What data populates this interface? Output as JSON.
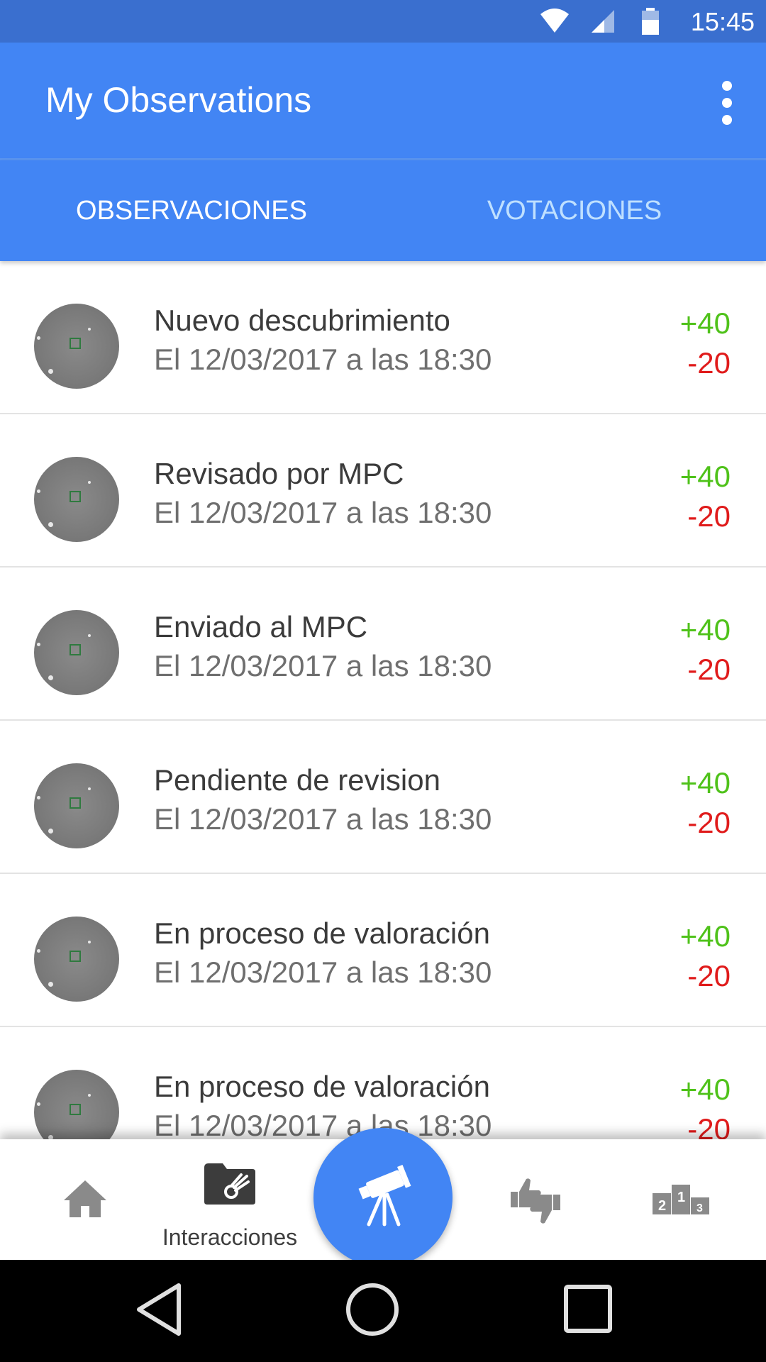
{
  "status_bar": {
    "time": "15:45",
    "icons": [
      "wifi-icon",
      "signal-icon",
      "battery-icon"
    ]
  },
  "app_bar": {
    "title": "My Observations",
    "menu_icon": "more-vert-icon"
  },
  "tabs": [
    {
      "label": "OBSERVACIONES",
      "active": true
    },
    {
      "label": "VOTACIONES",
      "active": false
    }
  ],
  "observations": [
    {
      "title": "Nuevo descubrimiento",
      "date": "El 12/03/2017 a las 18:30",
      "plus": "+40",
      "minus": "-20"
    },
    {
      "title": "Revisado por MPC",
      "date": "El 12/03/2017 a las 18:30",
      "plus": "+40",
      "minus": "-20"
    },
    {
      "title": "Enviado al MPC",
      "date": "El 12/03/2017 a las 18:30",
      "plus": "+40",
      "minus": "-20"
    },
    {
      "title": "Pendiente de revision",
      "date": "El 12/03/2017 a las 18:30",
      "plus": "+40",
      "minus": "-20"
    },
    {
      "title": "En proceso de valoración",
      "date": "El 12/03/2017 a las 18:30",
      "plus": "+40",
      "minus": "-20"
    },
    {
      "title": "En proceso de valoración",
      "date": "El 12/03/2017 a las 18:30",
      "plus": "+40",
      "minus": "-20"
    }
  ],
  "bottom_nav": {
    "items": [
      {
        "icon": "home-icon",
        "label": ""
      },
      {
        "icon": "comet-folder-icon",
        "label": "Interacciones"
      },
      {
        "icon": "telescope-icon",
        "label": ""
      },
      {
        "icon": "thumbs-up-down-icon",
        "label": ""
      },
      {
        "icon": "podium-icon",
        "label": ""
      }
    ]
  },
  "colors": {
    "primary": "#4285f4",
    "status_bar": "#3a6fcf",
    "positive": "#4fc21a",
    "negative": "#e01b1b"
  }
}
